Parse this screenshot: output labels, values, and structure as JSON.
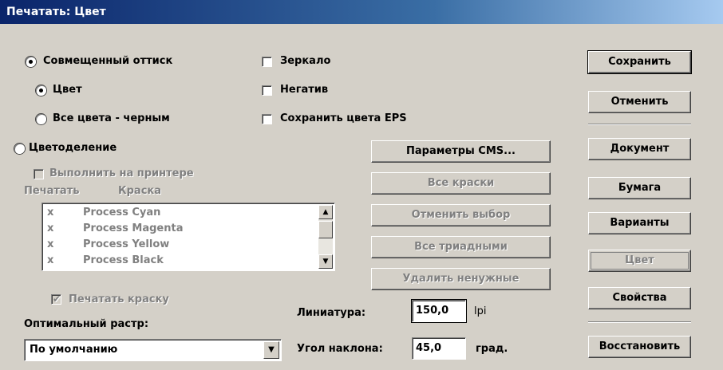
{
  "window": {
    "title": "Печатать: Цвет"
  },
  "options": {
    "composite": "Совмещенный оттиск",
    "color": "Цвет",
    "all_black": "Все цвета - черным",
    "separations": "Цветоделение",
    "on_printer": "Выполнить на принтере",
    "mirror": "Зеркало",
    "negative": "Негатив",
    "save_eps": "Сохранить цвета EPS"
  },
  "inks": {
    "col_print": "Печатать",
    "col_ink": "Краска",
    "rows": [
      {
        "mark": "x",
        "name": "Process Cyan"
      },
      {
        "mark": "x",
        "name": "Process Magenta"
      },
      {
        "mark": "x",
        "name": "Process Yellow"
      },
      {
        "mark": "x",
        "name": "Process Black"
      }
    ],
    "print_ink": "Печатать краску"
  },
  "middle_buttons": {
    "cms": "Параметры CMS...",
    "all_inks": "Все краски",
    "deselect": "Отменить выбор",
    "all_triad": "Все триадными",
    "remove_unused": "Удалить ненужные"
  },
  "screen": {
    "label": "Оптимальный растр:",
    "value": "По умолчанию",
    "lpi_label": "Линиатура:",
    "lpi_value": "150,0",
    "lpi_unit": "lpi",
    "angle_label": "Угол наклона:",
    "angle_value": "45,0",
    "angle_unit": "град."
  },
  "right_buttons": {
    "save": "Сохранить",
    "cancel": "Отменить",
    "document": "Документ",
    "paper": "Бумага",
    "options": "Варианты",
    "color": "Цвет",
    "properties": "Свойства",
    "restore": "Восстановить"
  },
  "colors": {
    "titlebar_start": "#0a246a",
    "titlebar_end": "#a6caf0",
    "face": "#d4d0c8"
  }
}
